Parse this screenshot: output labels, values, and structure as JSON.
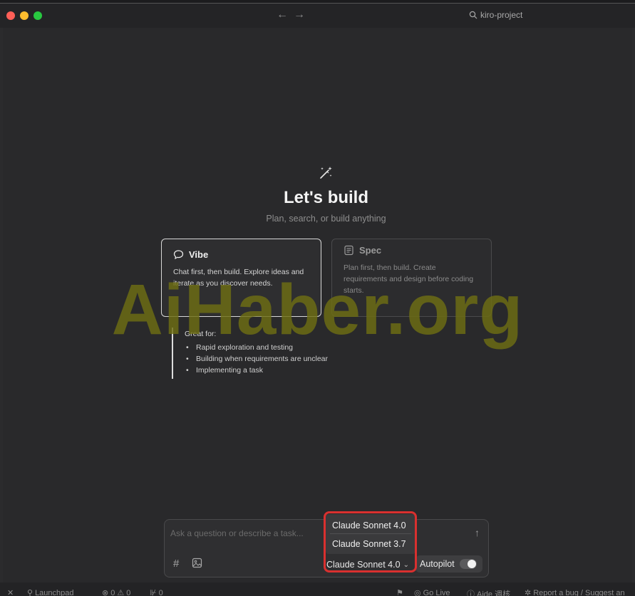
{
  "window": {
    "project_title": "kiro-project"
  },
  "hero": {
    "title": "Let's build",
    "subtitle": "Plan, search, or build anything"
  },
  "modes": [
    {
      "label": "Vibe",
      "description": "Chat first, then build. Explore ideas and iterate as you discover needs.",
      "selected": true
    },
    {
      "label": "Spec",
      "description": "Plan first, then build. Create requirements and design before coding starts.",
      "selected": false
    }
  ],
  "great_for": {
    "title": "Great for:",
    "items": [
      "Rapid exploration and testing",
      "Building when requirements are unclear",
      "Implementing a task"
    ]
  },
  "composer": {
    "placeholder": "Ask a question or describe a task...",
    "hash_label": "#",
    "selected_model": "Claude Sonnet 4.0",
    "autopilot_label": "Autopilot",
    "autopilot_on": true
  },
  "model_menu": {
    "options": [
      "Claude Sonnet 4.0",
      "Claude Sonnet 3.7"
    ]
  },
  "statusbar": {
    "launchpad": "Launchpad",
    "problems": "0 ⚠ 0",
    "ports": "0",
    "go_live": "Go Live",
    "aide": "Aide 週核",
    "report": "Report a bug / Suggest an"
  },
  "watermark": "AiHaber.org",
  "colors": {
    "highlight": "#d9302f",
    "watermark": "#6e6e14"
  }
}
